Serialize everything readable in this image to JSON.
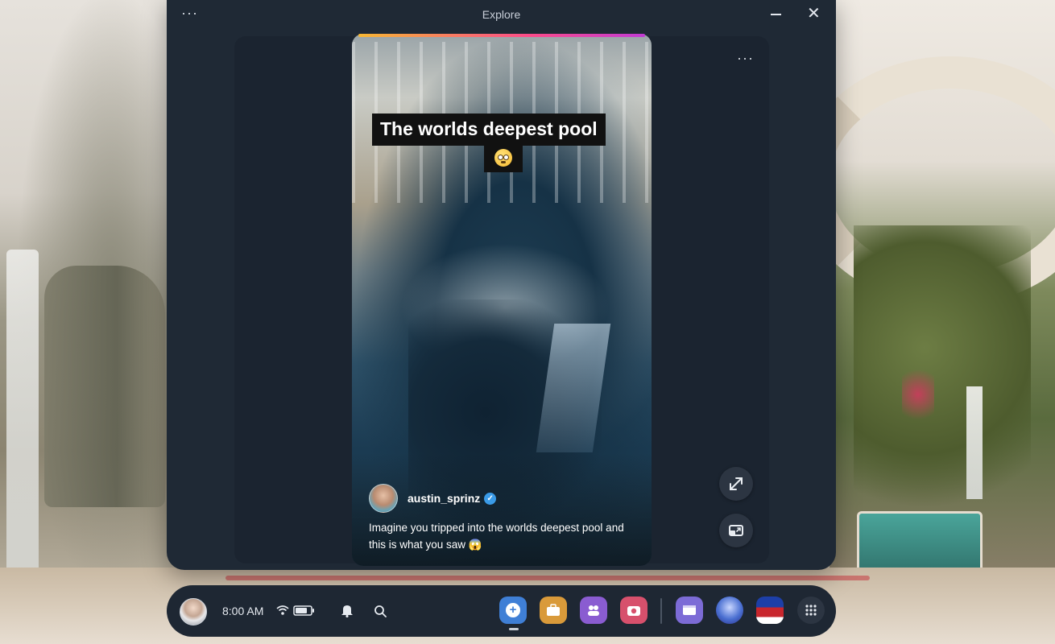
{
  "window": {
    "title": "Explore",
    "menu_glyph": "···",
    "close_glyph": "✕",
    "panel_menu_glyph": "···"
  },
  "reel": {
    "progress": 1.0,
    "caption": "The worlds deepest pool",
    "caption_emoji": "flushed-face-emoji",
    "author": "austin_sprinz",
    "verified": true,
    "verified_glyph": "✓",
    "description": "Imagine you tripped into the worlds deepest pool and this is what you saw 😱"
  },
  "side_actions": [
    {
      "name": "expand-icon"
    },
    {
      "name": "picture-in-picture-icon"
    }
  ],
  "taskbar": {
    "time": "8:00 AM",
    "status_icons": [
      "wifi-icon",
      "battery-icon"
    ],
    "quick_icons": [
      "bell-icon",
      "search-icon"
    ],
    "apps": [
      {
        "name": "store-app",
        "color": "#3f7fd6",
        "glyph": "+"
      },
      {
        "name": "inventory-app",
        "color": "#d99a3a",
        "glyph": "▣"
      },
      {
        "name": "people-app",
        "color": "#8a5cd1",
        "glyph": "⚇"
      },
      {
        "name": "camera-app",
        "color": "#d7506c",
        "glyph": "◉"
      },
      {
        "name": "browser-app",
        "color": "#7c6bd6",
        "glyph": "▭"
      },
      {
        "name": "game-app-1",
        "color": "#4a6fd1",
        "glyph": ""
      },
      {
        "name": "game-app-2",
        "color": "#c8262d",
        "glyph": ""
      }
    ],
    "grid_glyph": "∷"
  },
  "colors": {
    "window_bg": "#1f2935",
    "panel_bg": "#1b2430",
    "verified": "#3a9be8",
    "progress_start": "#f7b733",
    "progress_end": "#c13bd4"
  }
}
